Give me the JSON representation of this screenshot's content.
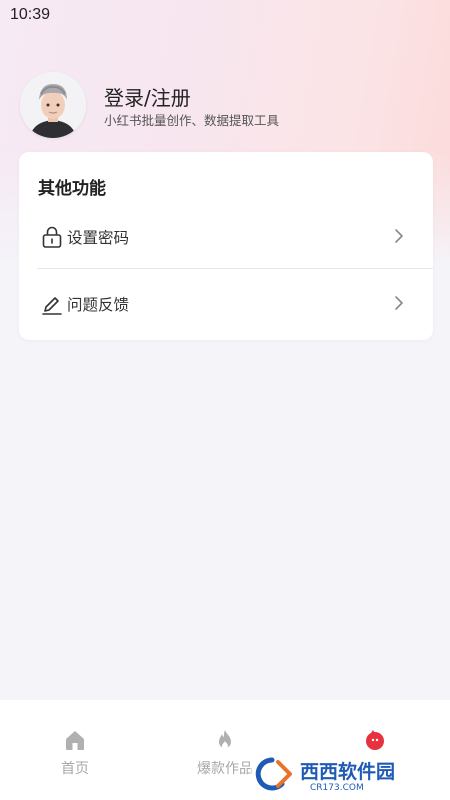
{
  "status_bar": {
    "time": "10:39"
  },
  "profile": {
    "title": "登录/注册",
    "subtitle": "小红书批量创作、数据提取工具",
    "avatar_icon": "avatar-3d-boy"
  },
  "card": {
    "title": "其他功能",
    "items": [
      {
        "label": "设置密码",
        "icon": "lock-icon"
      },
      {
        "label": "问题反馈",
        "icon": "edit-icon"
      }
    ]
  },
  "tabbar": {
    "tabs": [
      {
        "label": "首页",
        "icon": "home-icon",
        "active": false
      },
      {
        "label": "爆款作品",
        "icon": "flame-icon",
        "active": false
      },
      {
        "label": "",
        "icon": "mine-icon",
        "active": true
      }
    ]
  },
  "watermark": {
    "main": "西西软件园",
    "sub": "CR173.COM"
  },
  "colors": {
    "accent_red": "#e8313f",
    "inactive_gray": "#a8a8a8",
    "text_dark": "#222222"
  }
}
